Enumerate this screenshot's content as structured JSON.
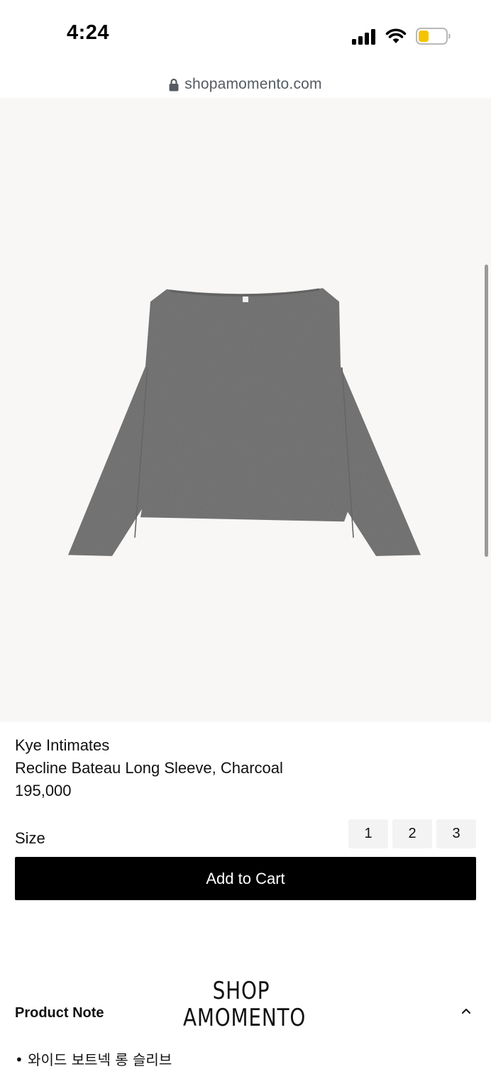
{
  "status_bar": {
    "time": "4:24",
    "battery_color": "#f5c400"
  },
  "url_bar": {
    "url": "shopamomento.com"
  },
  "product": {
    "image_icon": "charcoal-long-sleeve-top",
    "brand": "Kye Intimates",
    "name": "Recline Bateau Long Sleeve, Charcoal",
    "price": "195,000"
  },
  "size": {
    "label": "Size",
    "options": [
      "1",
      "2",
      "3"
    ]
  },
  "cart": {
    "button_label": "Add to Cart"
  },
  "logo": {
    "line1": "SHOP",
    "line2": "AMOMENTO"
  },
  "product_note": {
    "title": "Product Note",
    "items": [
      "• 와이드 보트넥 롱 슬리브"
    ]
  }
}
